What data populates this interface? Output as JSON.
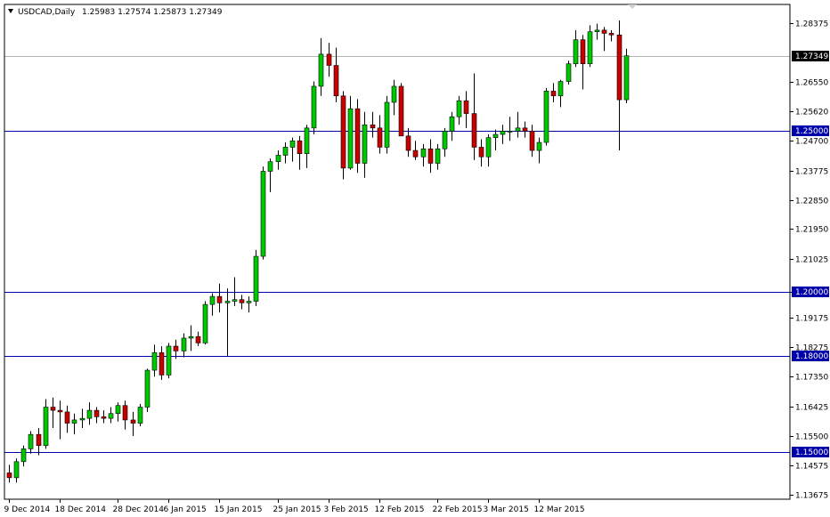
{
  "header": {
    "symbol": "USDCAD,Daily",
    "ohlc": "1.25983 1.27574 1.25873 1.27349"
  },
  "colors": {
    "frame": "#000000",
    "bull_body": "#00c800",
    "bear_body": "#c80000",
    "wick": "#000000",
    "level_line": "#0000aa",
    "level_label_bg": "#0000aa",
    "price_line": "#b4b4b4",
    "price_label_bg": "#000000",
    "label_text_on_dark": "#ffffff"
  },
  "chart_data": {
    "type": "candlestick",
    "y_range": [
      1.1353,
      1.2895
    ],
    "y_ticks": [
      "1.28375",
      "1.26550",
      "1.25620",
      "1.24700",
      "1.23775",
      "1.22850",
      "1.21950",
      "1.21025",
      "1.20000",
      "1.19175",
      "1.18275",
      "1.17350",
      "1.16425",
      "1.15500",
      "1.14575",
      "1.13675"
    ],
    "x_ticks": [
      {
        "label": "9 Dec 2014",
        "index": 0
      },
      {
        "label": "18 Dec 2014",
        "index": 7
      },
      {
        "label": "28 Dec 2014",
        "index": 15
      },
      {
        "label": "6 Jan 2015",
        "index": 22
      },
      {
        "label": "15 Jan 2015",
        "index": 29
      },
      {
        "label": "25 Jan 2015",
        "index": 37
      },
      {
        "label": "3 Feb 2015",
        "index": 44
      },
      {
        "label": "12 Feb 2015",
        "index": 51
      },
      {
        "label": "22 Feb 2015",
        "index": 59
      },
      {
        "label": "3 Mar 2015",
        "index": 66
      },
      {
        "label": "12 Mar 2015",
        "index": 73
      }
    ],
    "levels": [
      {
        "value": "1.25000"
      },
      {
        "value": "1.20000"
      },
      {
        "value": "1.18000"
      },
      {
        "value": "1.15000"
      }
    ],
    "current_price": "1.27349",
    "candles": [
      [
        1.1435,
        1.146,
        1.1405,
        1.142
      ],
      [
        1.142,
        1.148,
        1.1405,
        1.147
      ],
      [
        1.147,
        1.152,
        1.1455,
        1.151
      ],
      [
        1.151,
        1.1565,
        1.1495,
        1.1555
      ],
      [
        1.1555,
        1.1575,
        1.149,
        1.152
      ],
      [
        1.152,
        1.1665,
        1.151,
        1.164
      ],
      [
        1.164,
        1.167,
        1.1575,
        1.163
      ],
      [
        1.163,
        1.166,
        1.154,
        1.1625
      ],
      [
        1.1625,
        1.1645,
        1.156,
        1.159
      ],
      [
        1.159,
        1.162,
        1.1555,
        1.16
      ],
      [
        1.16,
        1.1635,
        1.1575,
        1.1605
      ],
      [
        1.1605,
        1.1655,
        1.1585,
        1.163
      ],
      [
        1.163,
        1.164,
        1.159,
        1.161
      ],
      [
        1.161,
        1.163,
        1.159,
        1.1605
      ],
      [
        1.1605,
        1.164,
        1.159,
        1.162
      ],
      [
        1.162,
        1.1655,
        1.1595,
        1.1645
      ],
      [
        1.1645,
        1.166,
        1.157,
        1.16
      ],
      [
        1.16,
        1.1625,
        1.155,
        1.159
      ],
      [
        1.159,
        1.165,
        1.158,
        1.164
      ],
      [
        1.164,
        1.176,
        1.1625,
        1.1755
      ],
      [
        1.1755,
        1.1835,
        1.1735,
        1.181
      ],
      [
        1.181,
        1.183,
        1.1725,
        1.174
      ],
      [
        1.174,
        1.184,
        1.173,
        1.183
      ],
      [
        1.183,
        1.185,
        1.179,
        1.1815
      ],
      [
        1.1815,
        1.187,
        1.1795,
        1.1855
      ],
      [
        1.1855,
        1.1895,
        1.1815,
        1.186
      ],
      [
        1.186,
        1.1875,
        1.183,
        1.184
      ],
      [
        1.184,
        1.197,
        1.1835,
        1.196
      ],
      [
        1.196,
        1.1995,
        1.1925,
        1.1985
      ],
      [
        1.1985,
        1.2025,
        1.1935,
        1.1965
      ],
      [
        1.1965,
        1.201,
        1.18,
        1.197
      ],
      [
        1.197,
        1.2045,
        1.1955,
        1.1975
      ],
      [
        1.1975,
        1.199,
        1.1945,
        1.1965
      ],
      [
        1.1965,
        1.1985,
        1.1935,
        1.197
      ],
      [
        1.197,
        1.213,
        1.1955,
        1.211
      ],
      [
        1.211,
        1.239,
        1.21,
        1.2375
      ],
      [
        1.2375,
        1.2415,
        1.231,
        1.2405
      ],
      [
        1.2405,
        1.244,
        1.238,
        1.2425
      ],
      [
        1.2425,
        1.2465,
        1.24,
        1.245
      ],
      [
        1.245,
        1.248,
        1.2405,
        1.247
      ],
      [
        1.247,
        1.2485,
        1.238,
        1.243
      ],
      [
        1.243,
        1.252,
        1.2385,
        1.251
      ],
      [
        1.251,
        1.2655,
        1.249,
        1.264
      ],
      [
        1.264,
        1.279,
        1.261,
        1.274
      ],
      [
        1.274,
        1.2775,
        1.267,
        1.2705
      ],
      [
        1.2705,
        1.276,
        1.259,
        1.261
      ],
      [
        1.261,
        1.2625,
        1.235,
        1.2385
      ],
      [
        1.2385,
        1.261,
        1.238,
        1.257
      ],
      [
        1.257,
        1.26,
        1.237,
        1.24
      ],
      [
        1.24,
        1.256,
        1.2355,
        1.252
      ],
      [
        1.252,
        1.256,
        1.248,
        1.251
      ],
      [
        1.251,
        1.255,
        1.243,
        1.245
      ],
      [
        1.245,
        1.261,
        1.243,
        1.259
      ],
      [
        1.259,
        1.266,
        1.255,
        1.264
      ],
      [
        1.264,
        1.265,
        1.249,
        1.2485
      ],
      [
        1.2485,
        1.251,
        1.242,
        1.244
      ],
      [
        1.244,
        1.247,
        1.241,
        1.242
      ],
      [
        1.242,
        1.246,
        1.239,
        1.2445
      ],
      [
        1.2445,
        1.2475,
        1.237,
        1.24
      ],
      [
        1.24,
        1.246,
        1.238,
        1.2445
      ],
      [
        1.2445,
        1.251,
        1.242,
        1.25
      ],
      [
        1.25,
        1.256,
        1.247,
        1.2545
      ],
      [
        1.2545,
        1.261,
        1.252,
        1.2595
      ],
      [
        1.2595,
        1.2625,
        1.251,
        1.2555
      ],
      [
        1.2555,
        1.268,
        1.241,
        1.245
      ],
      [
        1.245,
        1.2475,
        1.239,
        1.242
      ],
      [
        1.242,
        1.249,
        1.239,
        1.248
      ],
      [
        1.248,
        1.2505,
        1.244,
        1.249
      ],
      [
        1.249,
        1.252,
        1.246,
        1.25
      ],
      [
        1.25,
        1.2545,
        1.247,
        1.25
      ],
      [
        1.25,
        1.256,
        1.248,
        1.251
      ],
      [
        1.251,
        1.253,
        1.248,
        1.25
      ],
      [
        1.25,
        1.252,
        1.242,
        1.244
      ],
      [
        1.244,
        1.248,
        1.24,
        1.2465
      ],
      [
        1.2465,
        1.2635,
        1.2455,
        1.2625
      ],
      [
        1.2625,
        1.265,
        1.259,
        1.261
      ],
      [
        1.261,
        1.266,
        1.2575,
        1.2655
      ],
      [
        1.2655,
        1.272,
        1.2645,
        1.271
      ],
      [
        1.271,
        1.2815,
        1.27,
        1.2785
      ],
      [
        1.2785,
        1.28,
        1.263,
        1.271
      ],
      [
        1.271,
        1.283,
        1.27,
        1.281
      ],
      [
        1.281,
        1.2835,
        1.2785,
        1.2815
      ],
      [
        1.2815,
        1.2825,
        1.275,
        1.2805
      ],
      [
        1.2805,
        1.2815,
        1.278,
        1.28
      ],
      [
        1.28,
        1.2845,
        1.244,
        1.2598
      ],
      [
        1.2598,
        1.2757,
        1.2587,
        1.2735
      ]
    ]
  }
}
